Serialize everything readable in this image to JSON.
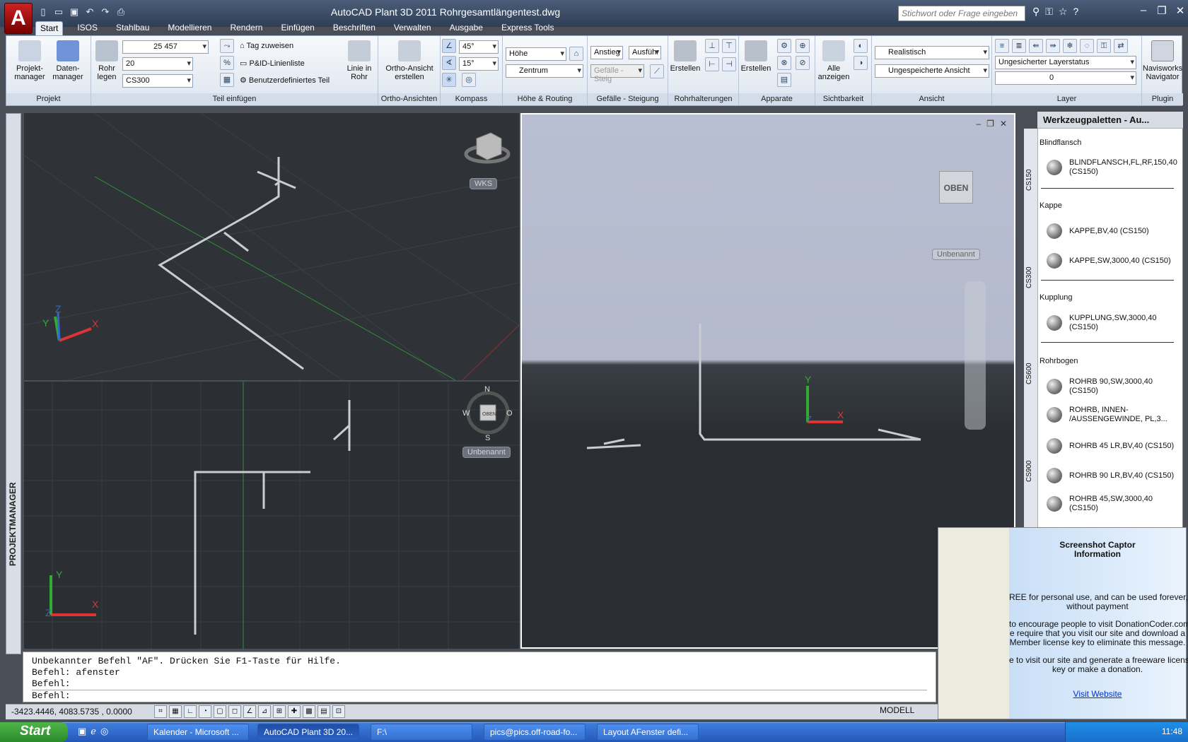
{
  "app": {
    "button_label": "A",
    "title": "AutoCAD Plant 3D 2011    Rohrgesamtlängentest.dwg",
    "search_placeholder": "Stichwort oder Frage eingeben"
  },
  "tabs": [
    "Start",
    "ISOS",
    "Stahlbau",
    "Modellieren",
    "Rendern",
    "Einfügen",
    "Beschriften",
    "Verwalten",
    "Ausgabe",
    "Express Tools"
  ],
  "ribbon": {
    "projekt": {
      "title": "Projekt",
      "btn1": "Projekt-\nmanager",
      "btn2": "Daten-\nmanager"
    },
    "teil": {
      "title": "Teil einfügen",
      "rohr": "Rohr\nlegen",
      "size": "25 457",
      "nd": "20",
      "spec": "CS300",
      "tag": "Tag zuweisen",
      "pid": "P&ID-Linienliste",
      "custom": "Benutzerdefiniertes Teil",
      "linie": "Linie in\nRohr"
    },
    "ortho": {
      "title": "Ortho-Ansichten",
      "btn": "Ortho-Ansicht\nerstellen"
    },
    "kompass": {
      "title": "Kompass",
      "angle1": "45°",
      "angle2": "15°"
    },
    "hoehe": {
      "title": "Höhe & Routing",
      "field": "Höhe",
      "zentrum": "Zentrum"
    },
    "gefaelle": {
      "title": "Gefälle - Steigung",
      "anstieg": "Anstieg",
      "ausfuehr": "Ausführ",
      "gf": "Gefälle - Steig"
    },
    "rohrhalt": {
      "title": "Rohrhalterungen",
      "btn": "Erstellen"
    },
    "apparate": {
      "title": "Apparate",
      "btn": "Erstellen"
    },
    "sicht": {
      "title": "Sichtbarkeit",
      "btn": "Alle\nanzeigen"
    },
    "ansicht": {
      "title": "Ansicht",
      "style": "Realistisch",
      "view": "Ungespeicherte Ansicht"
    },
    "layer": {
      "title": "Layer",
      "status": "Ungesicherter Layerstatus",
      "current": "0"
    },
    "plugin": {
      "title": "Plugin",
      "btn": "Navisworks\nNavigator"
    }
  },
  "sidebar": {
    "label": "PROJEKTMANAGER"
  },
  "viewports": {
    "vp1_ucs": "WKS",
    "vp2_ucs": "Unbenannt",
    "vp3_ucs": "Unbenannt",
    "vp3_cube": "OBEN",
    "vp2_cube": "OBEN",
    "compass": {
      "n": "N",
      "s": "S",
      "w": "W",
      "o": "O"
    },
    "axis": {
      "x": "X",
      "y": "Y",
      "z": "Z"
    }
  },
  "palette": {
    "title": "Werkzeugpaletten - Au...",
    "tabs": [
      "CS150",
      "CS300",
      "CS600",
      "CS900"
    ],
    "cats": [
      {
        "name": "Blindflansch",
        "items": [
          "BLINDFLANSCH,FL,RF,150,40\n(CS150)"
        ]
      },
      {
        "name": "Kappe",
        "items": [
          "KAPPE,BV,40 (CS150)",
          "KAPPE,SW,3000,40 (CS150)"
        ]
      },
      {
        "name": "Kupplung",
        "items": [
          "KUPPLUNG,SW,3000,40\n(CS150)"
        ]
      },
      {
        "name": "Rohrbogen",
        "items": [
          "ROHRB 90,SW,3000,40\n(CS150)",
          "ROHRB, INNEN-\n/AUSSENGEWINDE, PL,3...",
          "ROHRB 45 LR,BV,40 (CS150)",
          "ROHRB 90 LR,BV,40 (CS150)",
          "ROHRB 45,SW,3000,40\n(CS150)"
        ]
      }
    ]
  },
  "cmd": {
    "lines": [
      "Unbekannter Befehl \"AF\". Drücken Sie F1-Taste für Hilfe.",
      "Befehl: afenster",
      "Befehl:",
      "Befehl:"
    ]
  },
  "status": {
    "coords": "-3423.4446, 4083.5735 , 0.0000",
    "model": "MODELL"
  },
  "captor": {
    "title": "Screenshot Captor\nInformation",
    "p1": "REE for personal use, and can be used forever,\nwithout payment",
    "p2": "to encourage people to visit DonationCoder.com\ne require that you visit our site and download a\nMember license key to eliminate this message.",
    "p3": "e to visit our site and generate a freeware license\nkey or make a donation.",
    "link": "Visit Website"
  },
  "taskbar": {
    "start": "Start",
    "tasks": [
      "Kalender - Microsoft ...",
      "AutoCAD Plant 3D 20...",
      "F:\\",
      "pics@pics.off-road-fo...",
      "Layout AFenster defi..."
    ],
    "clock": "11:48"
  }
}
